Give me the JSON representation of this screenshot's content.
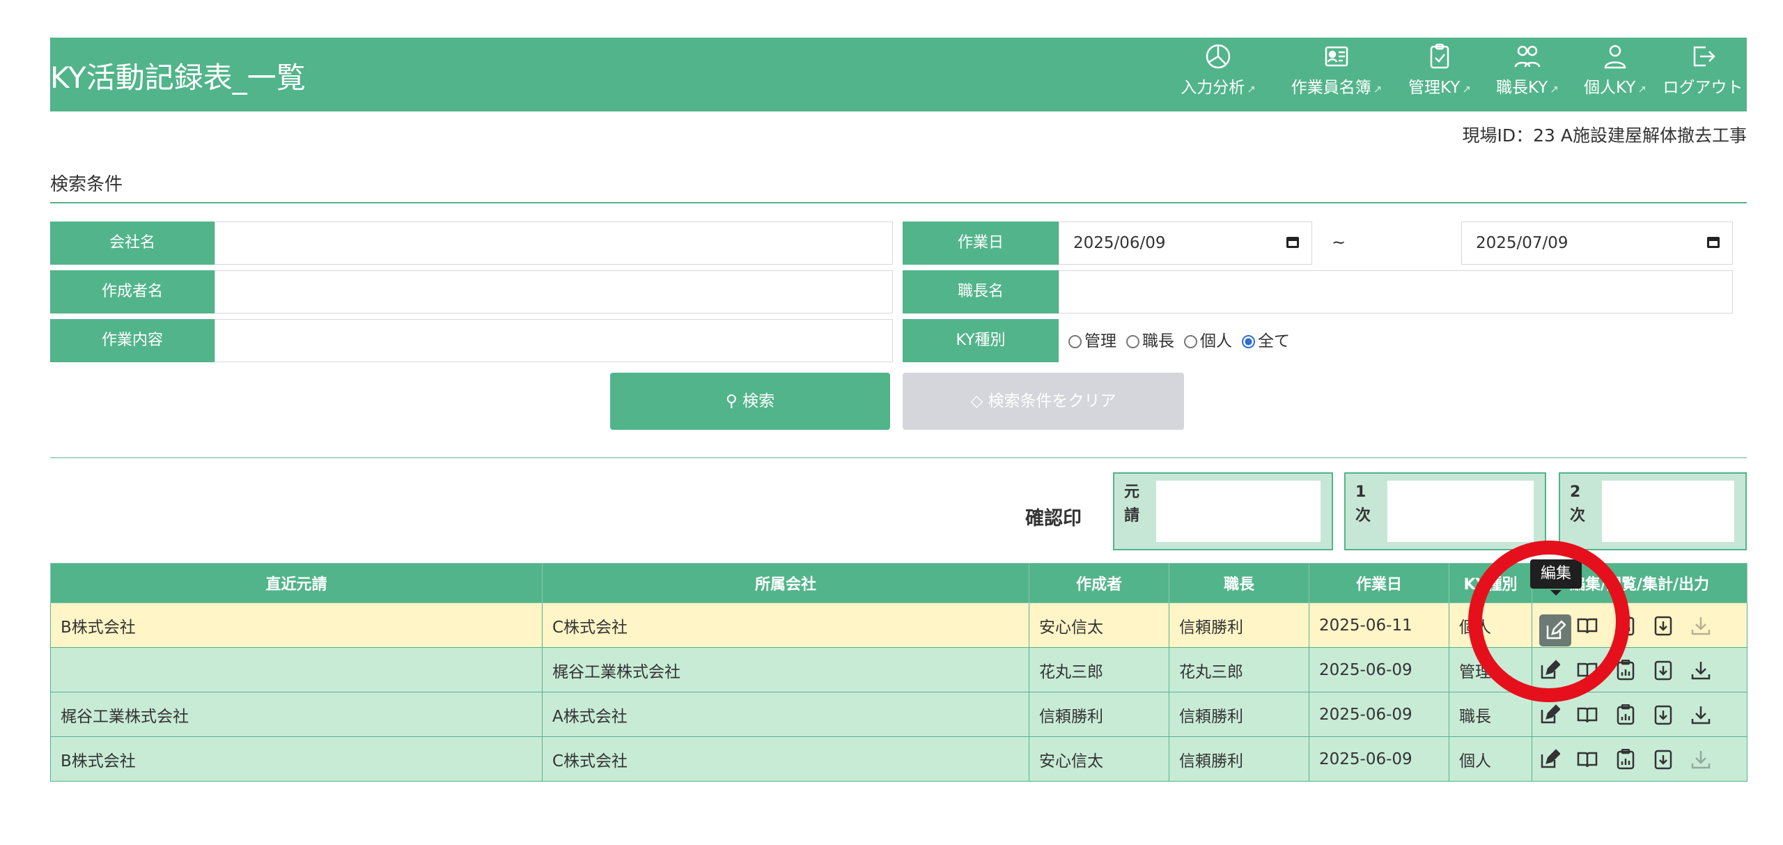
{
  "header": {
    "title": "KY活動記録表_一覧",
    "nav": [
      {
        "label": "入力分析",
        "icon": "pie-chart-icon"
      },
      {
        "label": "作業員名簿",
        "icon": "id-card-icon"
      },
      {
        "label": "管理KY",
        "icon": "clipboard-check-icon"
      },
      {
        "label": "職長KY",
        "icon": "users-icon"
      },
      {
        "label": "個人KY",
        "icon": "user-icon"
      },
      {
        "label": "ログアウト",
        "icon": "logout-icon"
      }
    ]
  },
  "site_id": "現場ID：23 A施設建屋解体撤去工事",
  "search": {
    "title": "検索条件",
    "company_label": "会社名",
    "company_value": "",
    "creator_label": "作成者名",
    "creator_value": "",
    "content_label": "作業内容",
    "content_value": "",
    "workdate_label": "作業日",
    "date_from": "2025/06/09",
    "date_sep": "~",
    "date_to": "2025/07/09",
    "foreman_label": "職長名",
    "foreman_value": "",
    "kytype_label": "KY種別",
    "kytype_options": [
      {
        "label": "管理",
        "selected": false
      },
      {
        "label": "職長",
        "selected": false
      },
      {
        "label": "個人",
        "selected": false
      },
      {
        "label": "全て",
        "selected": true
      }
    ],
    "search_button": "検索",
    "clear_button": "検索条件をクリア"
  },
  "stamps": {
    "label": "確認印",
    "boxes": [
      {
        "label": "元請",
        "value": ""
      },
      {
        "label": "1次",
        "value": ""
      },
      {
        "label": "2次",
        "value": ""
      }
    ]
  },
  "table": {
    "columns": [
      "直近元請",
      "所属会社",
      "作成者",
      "職長",
      "作業日",
      "KY種別",
      "編集/閲覧/集計/出力"
    ],
    "rows": [
      {
        "prime": "B株式会社",
        "company": "C株式会社",
        "creator": "安心信太",
        "foreman": "信頼勝利",
        "date": "2025-06-11",
        "type": "個人",
        "highlight": true,
        "download_enabled": false
      },
      {
        "prime": "",
        "company": "梶谷工業株式会社",
        "creator": "花丸三郎",
        "foreman": "花丸三郎",
        "date": "2025-06-09",
        "type": "管理",
        "highlight": false,
        "download_enabled": true
      },
      {
        "prime": "梶谷工業株式会社",
        "company": "A株式会社",
        "creator": "信頼勝利",
        "foreman": "信頼勝利",
        "date": "2025-06-09",
        "type": "職長",
        "highlight": false,
        "download_enabled": true
      },
      {
        "prime": "B株式会社",
        "company": "C株式会社",
        "creator": "安心信太",
        "foreman": "信頼勝利",
        "date": "2025-06-09",
        "type": "個人",
        "highlight": false,
        "download_enabled": false
      }
    ],
    "action_icons": [
      "edit-icon",
      "book-icon",
      "clipboard-chart-icon",
      "file-download-icon",
      "download-icon"
    ]
  },
  "tooltip": {
    "text": "編集"
  },
  "colors": {
    "accent": "#52b48a",
    "row_bg": "#c8ebd6",
    "row_highlight": "#fff5c7",
    "annotation_ring": "#e5101c"
  }
}
